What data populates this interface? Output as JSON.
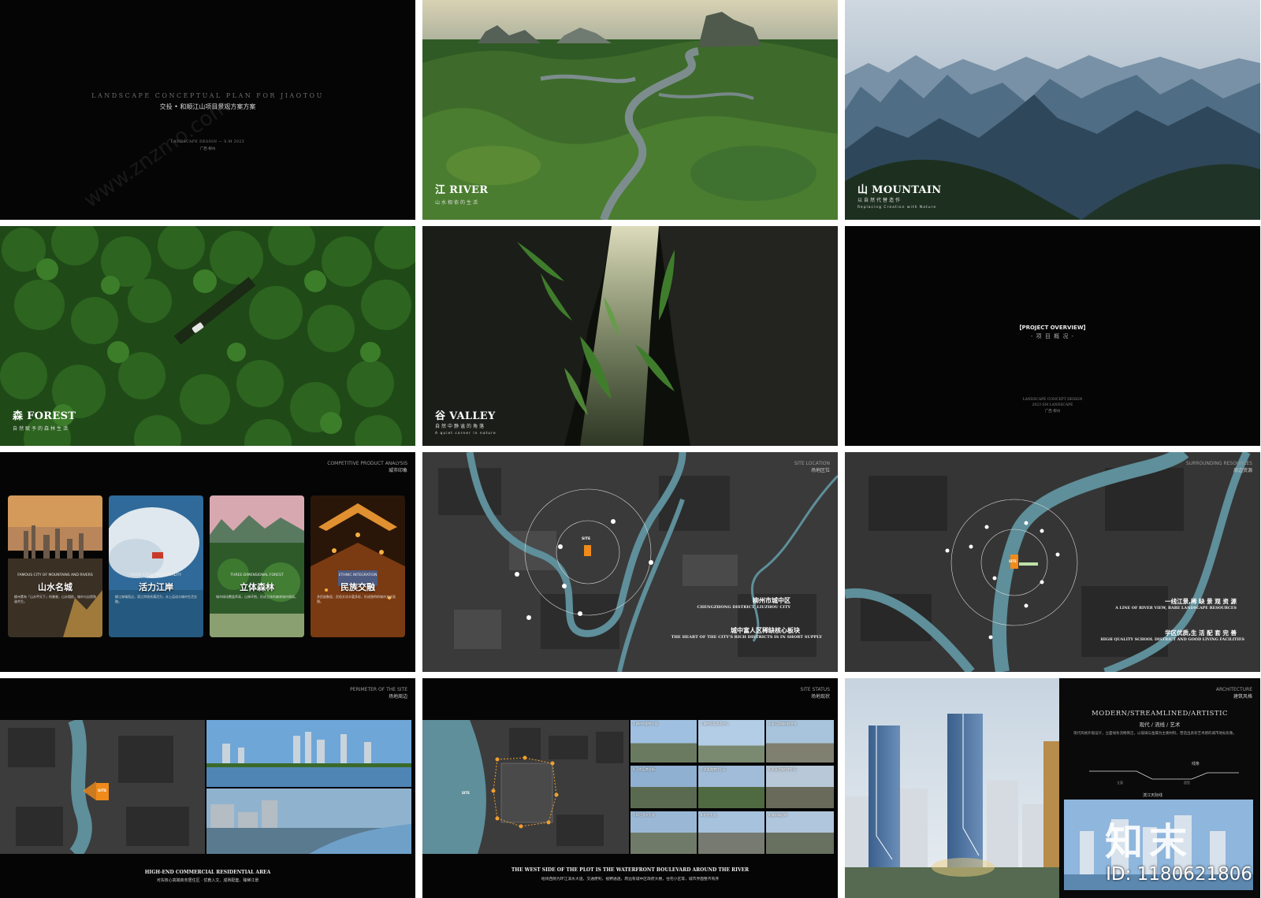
{
  "cover": {
    "title_en": "LANDSCAPE CONCEPTUAL PLAN FOR JIAOTOU",
    "title_cn": "交投 • 和顺江山项目景观方案方案",
    "credit": "LANDSCAPE  DESIGN — S.M 2023",
    "location": "广西 柳州"
  },
  "river": {
    "title": "江 RIVER",
    "subtitle": "山水相依的生活"
  },
  "mountain": {
    "title": "山 MOUNTAIN",
    "subtitle": "以自然代替造作",
    "subtitle_en": "Replacing Creation with Nature"
  },
  "forest": {
    "title": "森 FOREST",
    "subtitle": "自然赋予的森林生活"
  },
  "valley": {
    "title": "谷 VALLEY",
    "subtitle": "自然中静谧的角落",
    "subtitle_en": "A quiet corner in nature"
  },
  "overview": {
    "title_en": "【PROJECT OVERVIEW】",
    "title_cn": "- 项 目 概 况 -",
    "footer1": "LANDSCAPE CONCEPT DESIGN",
    "footer2": "2023  SM LANDSCAPE",
    "footer3": "广西 柳州"
  },
  "competitive": {
    "label_en": "COMPETITIVE PRODUCT ANALYSIS",
    "label_cn": "城市印象",
    "cards": [
      {
        "title": "山水名城",
        "en": "FAMOUS CITY OF MOUNTAINS AND RIVERS",
        "text": "柳州素有「山水甲天下」的美誉，山水相依，城市与自然和谐共生。"
      },
      {
        "title": "活力江岸",
        "en": "RIVER COAST WITH VITALITY",
        "text": "柳江穿城而过，滨江岸线充满活力，水上运动与城市生活交融。"
      },
      {
        "title": "立体森林",
        "en": "THREE-DIMENSIONAL FOREST",
        "text": "城市绿化覆盖率高，山林环抱，形成立体的森林城市格局。"
      },
      {
        "title": "民族交融",
        "en": "ETHNIC INTEGRATION",
        "text": "多民族聚居，民俗文化丰富多彩，形成独特的城市文化氛围。"
      }
    ]
  },
  "site_location": {
    "label_en": "SITE LOCATION",
    "label_cn": "场地区位",
    "site": "SITE",
    "district_cn": "柳州市城中区",
    "district_en": "CHENGZHONG DISTRICT, LIUZHOU CITY",
    "core_cn": "城中富人区稀缺核心板块",
    "core_en": "THE HEART OF THE CITY'S RICH DISTRICTS IS IN SHORT SUPPLY"
  },
  "resources": {
    "label_en": "SURROUNDING RESOURCES",
    "label_cn": "周边资源",
    "site": "SITE",
    "line1_cn": "一线江景,稀 缺 景 观 资 源",
    "line1_en": "A LINE OF RIVER VIEW, RARE LANDSCAPE RESOURCES",
    "line2_cn": "学区优质,生 活 配 套 完 善",
    "line2_en": "HIGH QUALITY SCHOOL DISTRICT AND GOOD LIVING FACILITIES"
  },
  "perimeter": {
    "label_en": "PERIMETER OF THE SITE",
    "label_cn": "场地周边",
    "site": "SITE",
    "caption_en": "HIGH-END COMMERCIAL RESIDENTIAL AREA",
    "caption_cn": "河东核心高端商务居住区 · 优教入文、成熟配套、臻稀江景"
  },
  "status": {
    "label_en": "SITE STATUS",
    "label_cn": "场地现状",
    "site": "SITE",
    "photos": [
      "1.柳州东郡府大楼",
      "2.柳州国际商务中心",
      "3.星河湾城市综合体",
      "4.河东区商业街",
      "5.文惠路商住小区",
      "6.荣泰龙城住宅小区",
      "7.环江滨水大道",
      "8.桂中大道",
      "9.城市绿化带"
    ],
    "caption_en": "THE WEST SIDE OF THE PLOT IS THE WATERFRONT BOULEVARD AROUND THE RIVER",
    "caption_cn": "地块西侧为环江滨水大道，交通便利，视野通透，周边有城中区政府大楼，住宅小区等，城市界面整齐有序"
  },
  "architecture": {
    "label_en": "ARCHITECTURE",
    "label_cn": "建筑风格",
    "title_en": "MODERN/STREAMLINED/ARTISTIC",
    "title_cn": "现代 / 流线 / 艺术",
    "desc": "现代风格外观设计，立面线条流畅简洁，以玻璃与金属为主要材料，营造出具有艺术感的城市地标形象。",
    "line_label": "线条",
    "left_label": "立面",
    "right_label": "造型",
    "skyline_label": "滨江天际线"
  },
  "brand": {
    "logo": "知末",
    "id": "ID: 1180621806",
    "watermark": "www.znzmo.com"
  }
}
